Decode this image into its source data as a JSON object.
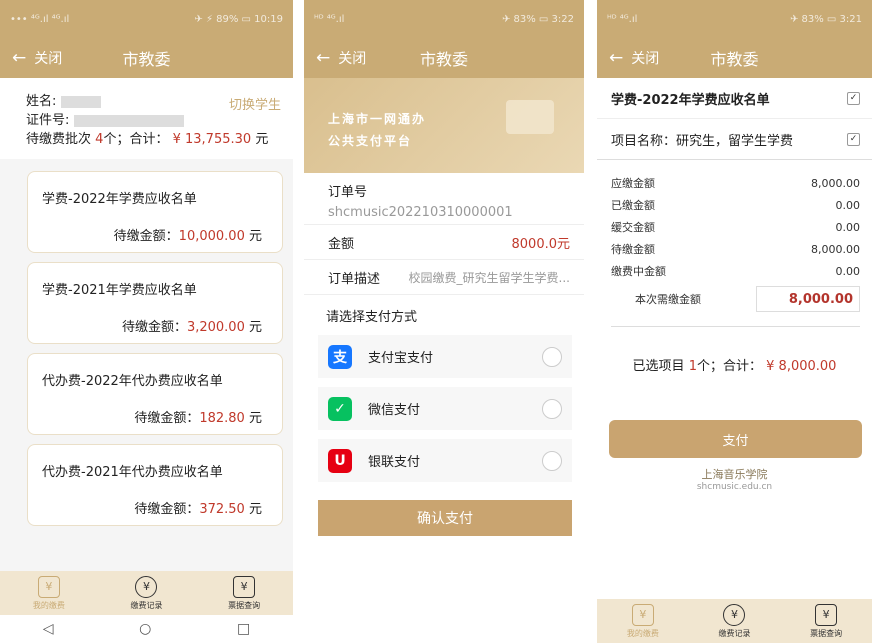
{
  "panel1": {
    "status": {
      "left": "••• ⁴ᴳ.ıl ⁴ᴳ.ıl",
      "right": "✈ ⚡ 89% ▭ 10:19"
    },
    "header": {
      "back": "←",
      "close": "关闭",
      "title": "市教委"
    },
    "student": {
      "name_label": "姓名:",
      "id_label": "证件号:",
      "switch_label": "切换学生",
      "pending_prefix": "待缴费批次",
      "pending_count": "4",
      "pending_mid": "个；合计：",
      "pending_total": "¥ 13,755.30",
      "pending_unit": "元"
    },
    "bills": [
      {
        "name": "学费-2022年学费应收名单",
        "amount_label": "待缴金额：",
        "amount": "10,000.00",
        "unit": "元"
      },
      {
        "name": "学费-2021年学费应收名单",
        "amount_label": "待缴金额：",
        "amount": "3,200.00",
        "unit": "元"
      },
      {
        "name": "代办费-2022年代办费应收名单",
        "amount_label": "待缴金额：",
        "amount": "182.80",
        "unit": "元"
      },
      {
        "name": "代办费-2021年代办费应收名单",
        "amount_label": "待缴金额：",
        "amount": "372.50",
        "unit": "元"
      }
    ],
    "tabs": [
      {
        "icon": "¥",
        "label": "我的缴费"
      },
      {
        "icon": "¥",
        "label": "缴费记录"
      },
      {
        "icon": "¥",
        "label": "票据查询"
      }
    ],
    "nav": {
      "back": "◁",
      "home": "○",
      "recent": "□"
    }
  },
  "panel2": {
    "status": {
      "left": "ᴴᴰ ⁴ᴳ.ıl",
      "right": "✈ 83% ▭ 3:22"
    },
    "header": {
      "back": "←",
      "close": "关闭",
      "title": "市教委"
    },
    "banner": {
      "line1": "上海市一网通办",
      "line2": "公共支付平台"
    },
    "order_label": "订单号",
    "order_no": "shcmusic202210310000001",
    "amount_label": "金额",
    "amount": "8000.0元",
    "desc_label": "订单描述",
    "desc": "校园缴费_研究生留学生学费...",
    "method_title": "请选择支付方式",
    "methods": [
      {
        "icon": "支",
        "label": "支付宝支付",
        "color": "#1677ff"
      },
      {
        "icon": "✓",
        "label": "微信支付",
        "color": "#07c160"
      },
      {
        "icon": "U",
        "label": "银联支付",
        "color": "#e60012"
      }
    ],
    "confirm": "确认支付"
  },
  "panel3": {
    "status": {
      "left": "ᴴᴰ ⁴ᴳ.ıl",
      "right": "✈ 83% ▭ 3:21"
    },
    "header": {
      "back": "←",
      "close": "关闭",
      "title": "市教委"
    },
    "bill_title": "学费-2022年学费应收名单",
    "item_label": "项目名称：研究生，留学生学费",
    "details": [
      {
        "label": "应缴金额",
        "value": "8,000.00"
      },
      {
        "label": "已缴金额",
        "value": "0.00"
      },
      {
        "label": "缓交金额",
        "value": "0.00"
      },
      {
        "label": "待缴金额",
        "value": "8,000.00"
      },
      {
        "label": "缴费中金额",
        "value": "0.00"
      }
    ],
    "due_label": "本次需缴金额",
    "due_value": "8,000.00",
    "summary_prefix": "已选项目",
    "summary_count": "1",
    "summary_mid": "个；合计：",
    "summary_total": "¥ 8,000.00",
    "pay": "支付",
    "school": "上海音乐学院",
    "school_url": "shcmusic.edu.cn",
    "tabs": [
      {
        "icon": "¥",
        "label": "我的缴费"
      },
      {
        "icon": "¥",
        "label": "缴费记录"
      },
      {
        "icon": "¥",
        "label": "票据查询"
      }
    ]
  }
}
